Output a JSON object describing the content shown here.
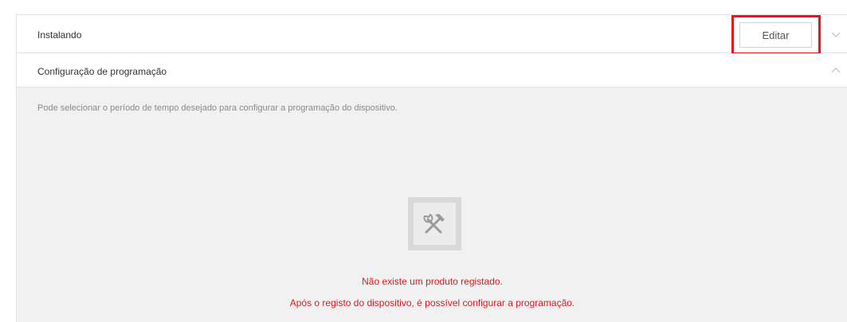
{
  "sections": {
    "installing": {
      "title": "Instalando",
      "edit_label": "Editar",
      "chevron_icon": "chevron-down-icon"
    },
    "schedule": {
      "title": "Configuração de programação",
      "chevron_icon": "chevron-up-icon",
      "description": "Pode selecionar o período de tempo desejado para configurar a programação do dispositivo.",
      "empty_state": {
        "icon": "tools-icon",
        "line1": "Não existe um produto registado.",
        "line2": "Após o registo do dispositivo, é possível configurar a programação."
      }
    }
  },
  "colors": {
    "highlight": "#e8141b",
    "message": "#e8141b",
    "content_background": "#f1f1f1"
  }
}
